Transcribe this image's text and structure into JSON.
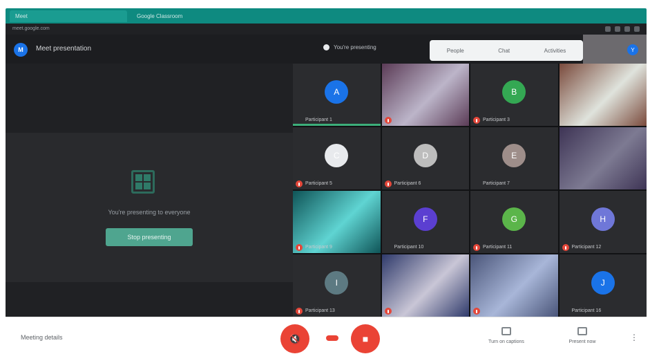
{
  "browser": {
    "tabs": [
      {
        "label": "Meet",
        "active": true
      },
      {
        "label": "Google Classroom",
        "active": false
      },
      {
        "label": "",
        "active": false
      }
    ],
    "address": "meet.google.com"
  },
  "meet": {
    "logo_letter": "M",
    "title": "Meet presentation",
    "recording_text": "You're presenting",
    "header_panel": [
      "People",
      "Chat",
      "Activities"
    ],
    "self_initial": "Y"
  },
  "present": {
    "text": "You're presenting to everyone",
    "button": "Stop presenting"
  },
  "participants": [
    {
      "name": "Participant 1",
      "avatar_color": "#1a73e8",
      "initial": "A",
      "muted": false,
      "speaking": true,
      "video": false
    },
    {
      "name": "",
      "video": true,
      "muted": true,
      "speaking": false,
      "photo_colors": [
        "#5b3b56",
        "#bcb5c9"
      ]
    },
    {
      "name": "Participant 3",
      "avatar_color": "#34a853",
      "initial": "B",
      "muted": true,
      "speaking": false,
      "video": false
    },
    {
      "name": "",
      "video": true,
      "muted": false,
      "speaking": false,
      "photo_colors": [
        "#7a4a3c",
        "#dfe3dc"
      ]
    },
    {
      "name": "Participant 5",
      "avatar_color": "#e8eaed",
      "initial": "C",
      "muted": true,
      "speaking": false,
      "video": false
    },
    {
      "name": "Participant 6",
      "avatar_color": "#bdbdbd",
      "initial": "D",
      "muted": true,
      "speaking": false,
      "video": false
    },
    {
      "name": "Participant 7",
      "avatar_color": "#9e8e8a",
      "initial": "E",
      "muted": false,
      "speaking": false,
      "video": false
    },
    {
      "name": "",
      "video": true,
      "muted": false,
      "speaking": false,
      "photo_colors": [
        "#3e3455",
        "#7d7a92"
      ]
    },
    {
      "name": "Participant 9",
      "video": true,
      "muted": true,
      "speaking": false,
      "photo_colors": [
        "#0f5457",
        "#5fd4d2"
      ]
    },
    {
      "name": "Participant 10",
      "avatar_color": "#5b3fd1",
      "initial": "F",
      "muted": false,
      "speaking": false,
      "video": false
    },
    {
      "name": "Participant 11",
      "avatar_color": "#5bb54a",
      "initial": "G",
      "muted": true,
      "speaking": false,
      "video": false
    },
    {
      "name": "Participant 12",
      "avatar_color": "#6f77d8",
      "initial": "H",
      "muted": true,
      "speaking": false,
      "video": false
    },
    {
      "name": "Participant 13",
      "avatar_color": "#5d7a82",
      "initial": "I",
      "muted": true,
      "speaking": false,
      "video": false
    },
    {
      "name": "",
      "video": true,
      "muted": true,
      "speaking": false,
      "photo_colors": [
        "#2f3a6b",
        "#c9c6d6"
      ]
    },
    {
      "name": "",
      "video": true,
      "muted": true,
      "speaking": false,
      "photo_colors": [
        "#4a5579",
        "#a8b6d8"
      ]
    },
    {
      "name": "Participant 16",
      "avatar_color": "#1a73e8",
      "initial": "J",
      "muted": false,
      "speaking": false,
      "video": false
    }
  ],
  "controls": {
    "meeting_details": "Meeting details",
    "mic_icon": "mic-off-icon",
    "cam_icon": "camera-off-icon",
    "right_buttons": [
      "Turn on captions",
      "Present now"
    ],
    "more": "⋮"
  },
  "colors": {
    "teal_tabbar": "#0e8a80",
    "meet_bg": "#1c1d20",
    "red_controls": "#ea4335",
    "present_button": "#4fa58f"
  }
}
